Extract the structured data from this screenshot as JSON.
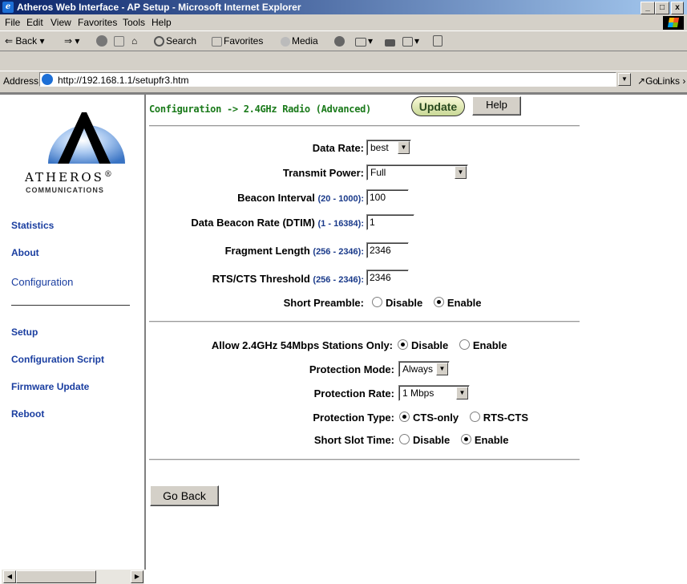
{
  "window": {
    "title": "Atheros Web Interface - AP Setup - Microsoft Internet Explorer",
    "min": "_",
    "max": "□",
    "close": "x"
  },
  "menu": [
    "File",
    "Edit",
    "View",
    "Favorites",
    "Tools",
    "Help"
  ],
  "toolbar": {
    "back": "Back",
    "search": "Search",
    "favorites": "Favorites",
    "media": "Media"
  },
  "address": {
    "label": "Address",
    "url": "http://192.168.1.1/setupfr3.htm",
    "go": "Go",
    "links": "Links"
  },
  "sidebar": {
    "logo_name": "ATHEROS",
    "logo_reg": "®",
    "logo_sub": "COMMUNICATIONS",
    "links": [
      "Statistics",
      "About"
    ],
    "current": "Configuration",
    "links2": [
      "Setup",
      "Configuration Script",
      "Firmware Update",
      "Reboot"
    ]
  },
  "header": {
    "breadcrumb": "Configuration -> 2.4GHz Radio (Advanced)",
    "update": "Update",
    "help": "Help"
  },
  "form": {
    "data_rate_label": "Data Rate:",
    "data_rate_value": "best",
    "tx_power_label": "Transmit Power:",
    "tx_power_value": "Full",
    "beacon_label": "Beacon Interval",
    "beacon_range": "(20 - 1000):",
    "beacon_value": "100",
    "dtim_label": "Data Beacon Rate (DTIM)",
    "dtim_range": "(1 - 16384):",
    "dtim_value": "1",
    "frag_label": "Fragment Length",
    "frag_range": "(256 - 2346):",
    "frag_value": "2346",
    "rts_label": "RTS/CTS Threshold",
    "rts_range": "(256 - 2346):",
    "rts_value": "2346",
    "preamble_label": "Short Preamble:",
    "preamble_disable": "Disable",
    "preamble_enable": "Enable",
    "allow54_label": "Allow 2.4GHz 54Mbps Stations Only:",
    "allow54_disable": "Disable",
    "allow54_enable": "Enable",
    "prot_mode_label": "Protection Mode:",
    "prot_mode_value": "Always",
    "prot_rate_label": "Protection Rate:",
    "prot_rate_value": "1 Mbps",
    "prot_type_label": "Protection Type:",
    "prot_type_cts": "CTS-only",
    "prot_type_rts": "RTS-CTS",
    "slot_label": "Short Slot Time:",
    "slot_disable": "Disable",
    "slot_enable": "Enable"
  },
  "go_back": "Go Back",
  "colors": {
    "breadcrumb": "#1a7a1a",
    "range": "#1a3a8a",
    "link": "#1a3ea0"
  }
}
